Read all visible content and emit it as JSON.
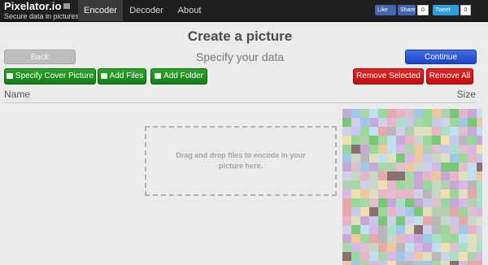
{
  "brand": {
    "title": "Pixelator.io",
    "subtitle": "Secure data in pictures"
  },
  "nav": {
    "tabs": [
      "Encoder",
      "Decoder",
      "About"
    ],
    "active": "Encoder"
  },
  "social": {
    "like": "Like",
    "share": "Share",
    "share_count": "0",
    "tweet": "Tweet",
    "tweet_count": "0"
  },
  "page": {
    "title": "Create a picture",
    "step": "Specify your data"
  },
  "buttons": {
    "back": "Back",
    "continue": "Continue",
    "cover": "Specify Cover Picture",
    "add_files": "Add Files",
    "add_folder": "Add Folder",
    "remove_selected": "Remove Selected",
    "remove_all": "Remove All"
  },
  "list": {
    "col_name": "Name",
    "col_size": "Size"
  },
  "dropzone": {
    "text": "Drag and drop files to encode in your picture here."
  },
  "colors": {
    "navbar": "#1f1f1f",
    "continue": "#1d43c8",
    "green": "#1d8f1d",
    "red": "#d11717"
  }
}
